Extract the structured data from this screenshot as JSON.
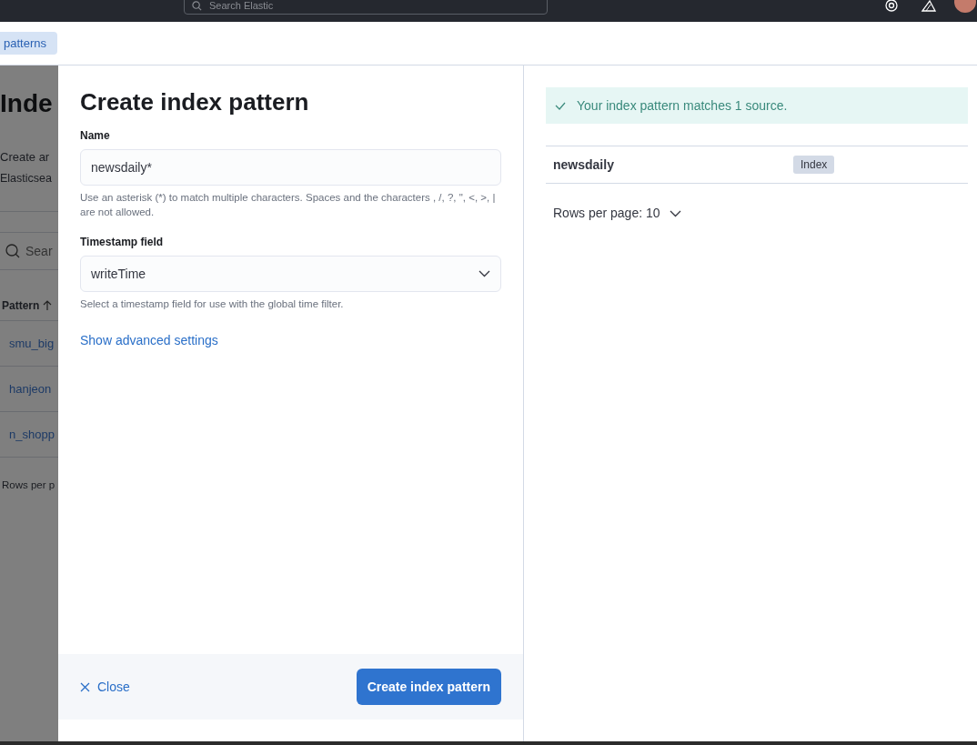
{
  "top_bar": {
    "search": {
      "placeholder": "Search Elastic"
    }
  },
  "breadcrumb": {
    "label": "patterns"
  },
  "background_page": {
    "title": "Inde",
    "description": [
      "Create ar",
      "Elasticsea"
    ],
    "search": {
      "placeholder": "Sear"
    },
    "column": "Pattern",
    "rows": [
      "smu_big",
      "hanjeon",
      "n_shopp"
    ],
    "pagination": "Rows per p"
  },
  "flyout": {
    "title": "Create index pattern",
    "fields": [
      {
        "kind": "text",
        "label": "Name",
        "value": "newsdaily*",
        "help": "Use an asterisk (*) to match multiple characters. Spaces and the characters , /, ?, \", <, >, | are not allowed."
      },
      {
        "kind": "select",
        "label": "Timestamp field",
        "value": "writeTime",
        "help": "Select a timestamp field for use with the global time filter."
      }
    ],
    "advanced_link": "Show advanced settings",
    "close": "Close",
    "submit": "Create index pattern"
  },
  "preview": {
    "callout": "Your index pattern matches 1 source.",
    "rows": [
      {
        "name": "newsdaily",
        "type": "Index"
      }
    ],
    "pagination": "Rows per page: 10"
  }
}
